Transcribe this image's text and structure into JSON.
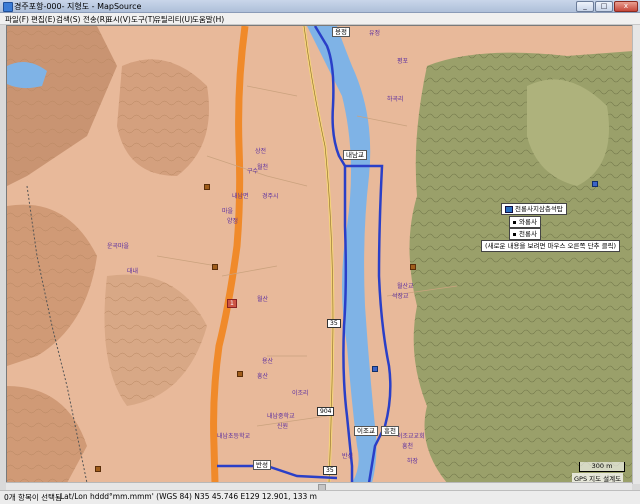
{
  "window": {
    "title": "경주포항-000- 지형도 - MapSource",
    "buttons": {
      "minimize": "_",
      "maximize": "□",
      "close": "x"
    }
  },
  "menu": [
    "파일(F)",
    "편집(E)",
    "검색(S)",
    "전송(R)",
    "표시(V)",
    "도구(T)",
    "유틸리티(U)",
    "도움말(H)"
  ],
  "map": {
    "labels": [
      "용정",
      "유정",
      "하곡리",
      "평포",
      "용정",
      "월천",
      "운곡마을",
      "상전",
      "구수",
      "내남면",
      "경주시",
      "마을",
      "양정",
      "대내",
      "월산",
      "이조리",
      "용산",
      "흥산",
      "신원",
      "반성",
      "이조교",
      "흥천",
      "하장",
      "내남교",
      "내남중학교",
      "내남초등학교",
      "이조교교회",
      "월산교",
      "석장교"
    ],
    "road_signs": [
      "1",
      "35",
      "904",
      "35"
    ],
    "popup": {
      "title": "천룡사지삼층석탑",
      "items": [
        "와룡사",
        "천룡사"
      ],
      "hint": "(새로운 내용을 보려면 마우스 오른쪽 단추 클릭)"
    },
    "scale": "300 m",
    "credit": "GPS 지도 설계도"
  },
  "status": {
    "selection": "0개 항목이 선택됨",
    "position": "Lat/Lon hddd°mm.mmm' (WGS 84)    N35 45.746 E129 12.901, 133 m"
  },
  "colors": {
    "terrain": "#e8b99a",
    "forest": "#9aa06a",
    "river": "#7fb3e6",
    "route": "#2a3fc8",
    "highway": "#f08a2a",
    "road": "#f4d27a"
  }
}
